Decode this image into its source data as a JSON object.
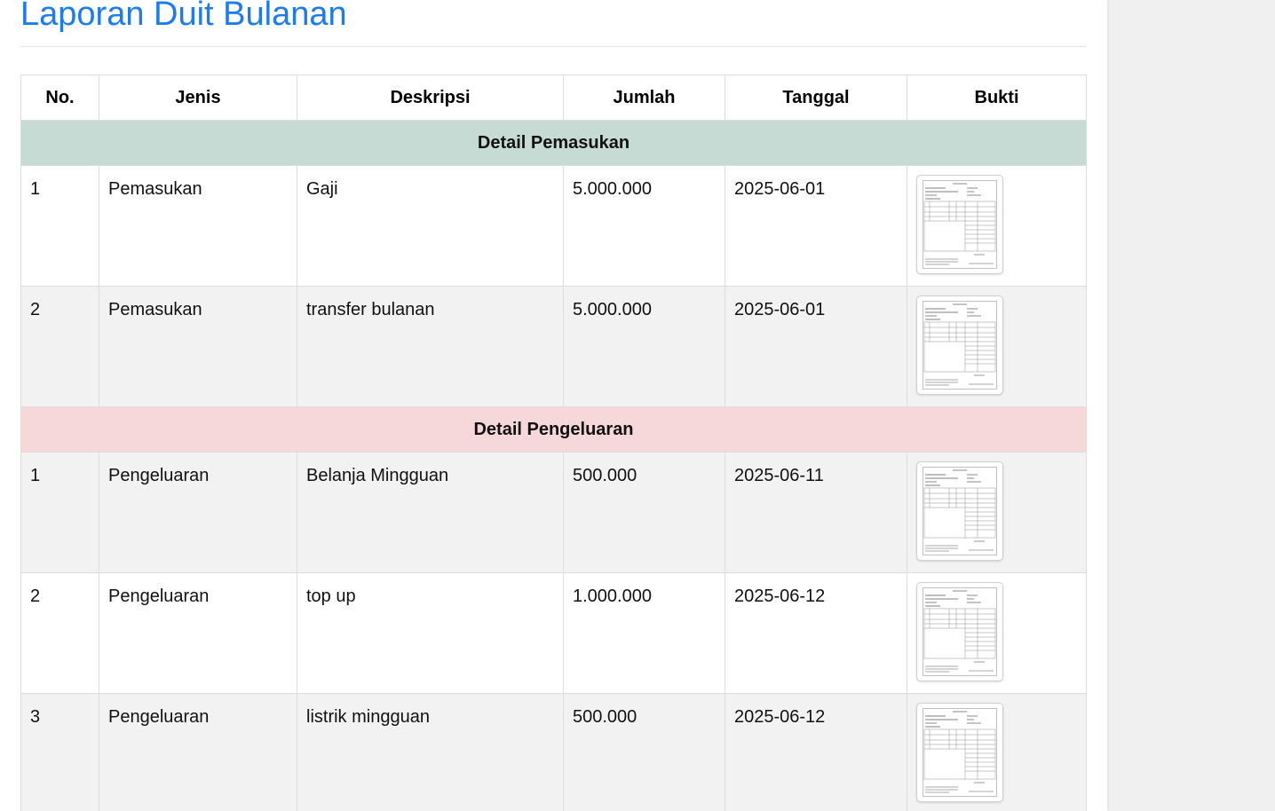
{
  "page": {
    "title": "Laporan Duit Bulanan"
  },
  "table": {
    "headers": [
      "No.",
      "Jenis",
      "Deskripsi",
      "Jumlah",
      "Tanggal",
      "Bukti"
    ],
    "income_section_label": "Detail Pemasukan",
    "expense_section_label": "Detail Pengeluaran",
    "income_rows": [
      {
        "no": "1",
        "jenis": "Pemasukan",
        "deskripsi": "Gaji",
        "jumlah": "5.000.000",
        "tanggal": "2025-06-01",
        "bukti_icon": "receipt-thumbnail-icon"
      },
      {
        "no": "2",
        "jenis": "Pemasukan",
        "deskripsi": "transfer bulanan",
        "jumlah": "5.000.000",
        "tanggal": "2025-06-01",
        "bukti_icon": "receipt-thumbnail-icon"
      }
    ],
    "expense_rows": [
      {
        "no": "1",
        "jenis": "Pengeluaran",
        "deskripsi": "Belanja Mingguan",
        "jumlah": "500.000",
        "tanggal": "2025-06-11",
        "bukti_icon": "receipt-thumbnail-icon"
      },
      {
        "no": "2",
        "jenis": "Pengeluaran",
        "deskripsi": "top up",
        "jumlah": "1.000.000",
        "tanggal": "2025-06-12",
        "bukti_icon": "receipt-thumbnail-icon"
      },
      {
        "no": "3",
        "jenis": "Pengeluaran",
        "deskripsi": "listrik mingguan",
        "jumlah": "500.000",
        "tanggal": "2025-06-12",
        "bukti_icon": "receipt-thumbnail-icon"
      }
    ]
  },
  "colors": {
    "title": "#1a7cf0",
    "income_section_bg": "#c6dbd3",
    "expense_section_bg": "#f6d7da",
    "alt_row_bg": "#f2f2f2"
  }
}
